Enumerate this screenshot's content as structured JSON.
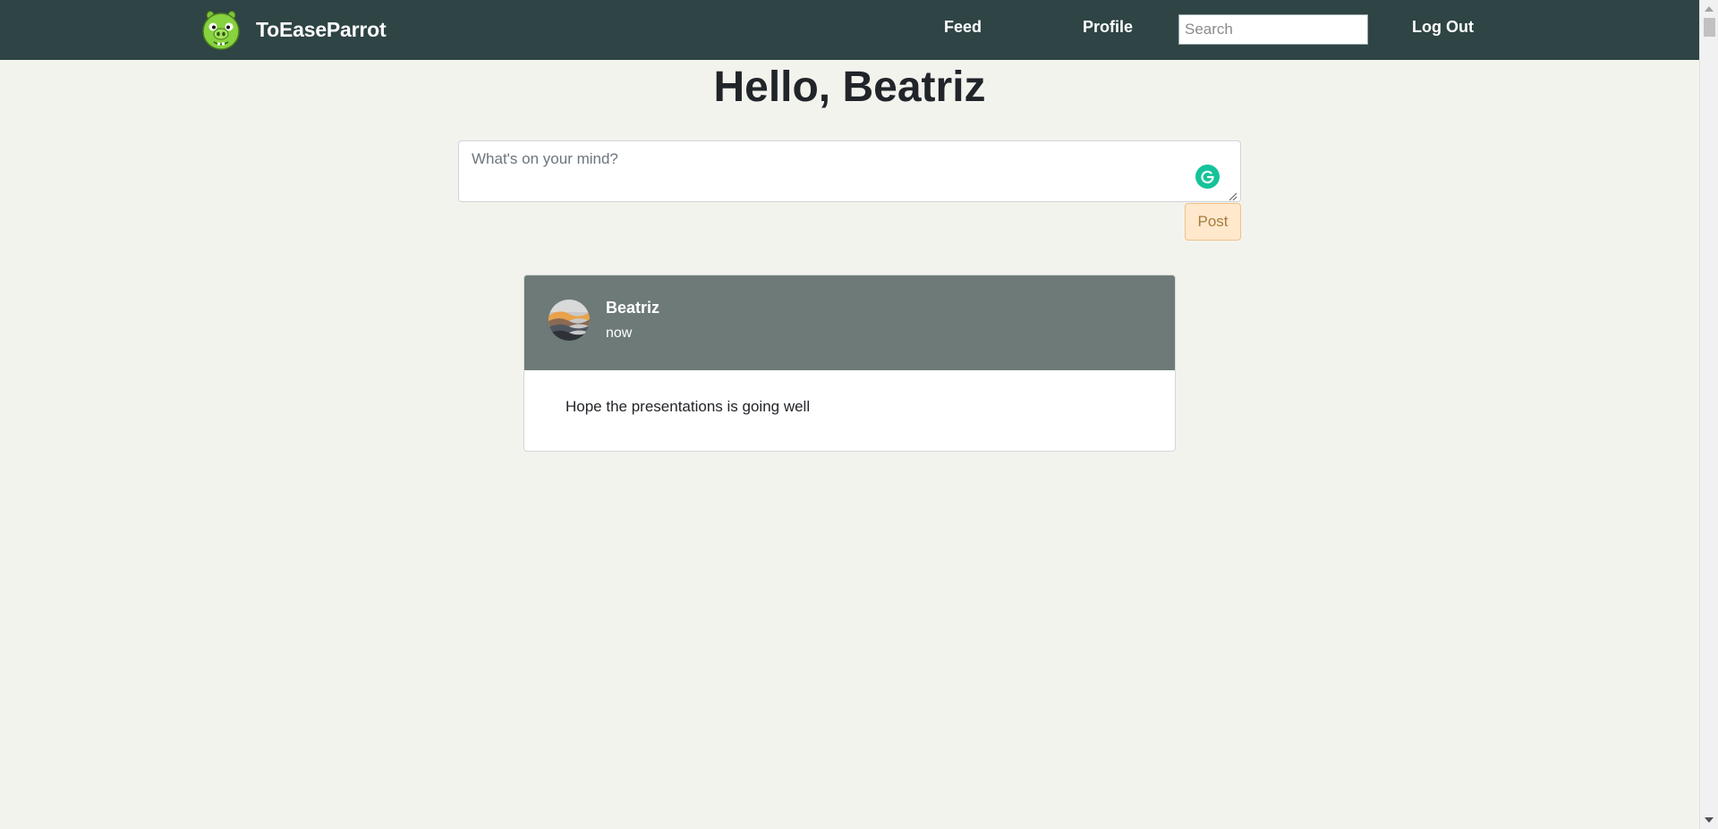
{
  "navbar": {
    "brand": "ToEaseParrot",
    "links": {
      "feed": "Feed",
      "profile": "Profile",
      "logout": "Log Out"
    },
    "search_placeholder": "Search",
    "logo_icon": "green-pig-logo-icon"
  },
  "greeting": "Hello, Beatriz",
  "composer": {
    "placeholder": "What's on your mind?",
    "post_label": "Post",
    "assistant_icon": "grammarly-icon"
  },
  "posts": [
    {
      "author": "Beatriz",
      "time": "now",
      "content": "Hope the presentations is going well"
    }
  ],
  "colors": {
    "navbar": "#2f4444",
    "page_background": "#f3f3ee",
    "post_header": "#6d7a78",
    "post_button_bg": "#ffe8cc",
    "grammarly": "#15c39a"
  }
}
